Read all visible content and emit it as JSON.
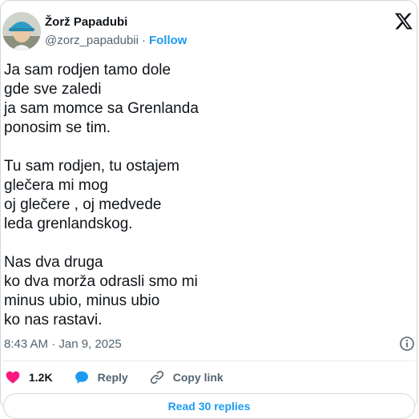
{
  "author": {
    "name": "Žorž Papadubi",
    "handle": "@zorz_papadubii",
    "separator": "·",
    "follow_label": "Follow"
  },
  "tweet": {
    "stanzas": [
      [
        "Ja sam rodjen tamo dole",
        "gde sve zaledi",
        "ja sam momce sa Grenlanda",
        "ponosim se tim."
      ],
      [
        "Tu sam rodjen, tu ostajem",
        "glečera mi mog",
        "oj glečere , oj medvede",
        "leda grenlandskog."
      ],
      [
        "Nas dva druga",
        "ko dva morža odrasli smo mi",
        "minus ubio, minus ubio",
        "ko nas rastavi."
      ]
    ],
    "timestamp": "8:43 AM · Jan 9, 2025"
  },
  "actions": {
    "likes_count": "1.2K",
    "reply_label": "Reply",
    "copy_link_label": "Copy link"
  },
  "footer": {
    "read_replies_label": "Read 30 replies"
  },
  "colors": {
    "like": "#f91880",
    "reply": "#1d9bf0",
    "link": "#1d9bf0",
    "muted": "#536471"
  },
  "icons": [
    "x-logo-icon",
    "info-icon",
    "heart-icon",
    "reply-bubble-icon",
    "link-icon"
  ]
}
